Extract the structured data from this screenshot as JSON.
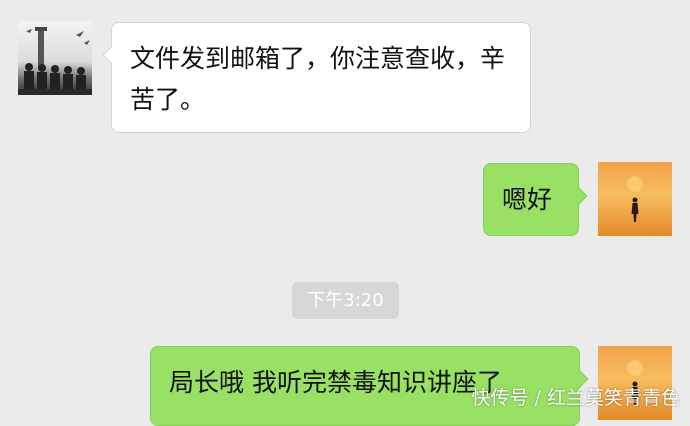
{
  "chat": {
    "messages": [
      {
        "side": "left",
        "text": "文件发到邮箱了，你注意查收，辛苦了。"
      },
      {
        "side": "right",
        "text": "嗯好"
      },
      {
        "side": "right",
        "text": "局长哦 我听完禁毒知识讲座了"
      }
    ],
    "timestamp": "下午3:20"
  },
  "watermark": "快传号 / 红兰莫笑青青色",
  "colors": {
    "background": "#ebebeb",
    "incoming_bubble": "#ffffff",
    "outgoing_bubble": "#98e165",
    "timestamp_pill": "#d7d7d7"
  },
  "icons": {
    "left_avatar": "police-avatar-icon",
    "right_avatar": "sunset-silhouette-avatar-icon"
  }
}
